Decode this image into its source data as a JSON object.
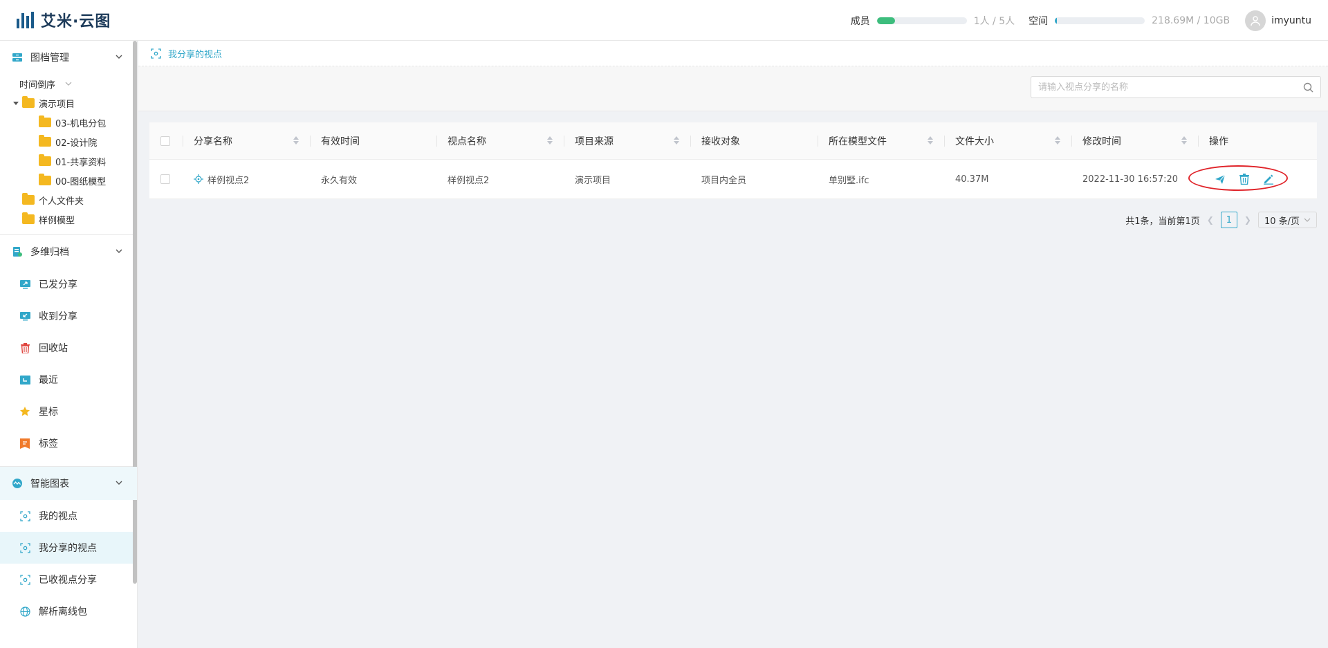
{
  "header": {
    "brand": "艾米·云图",
    "members_label": "成员",
    "members_value": "1人 / 5人",
    "members_progress": 0.2,
    "space_label": "空间",
    "space_value": "218.69M / 10GB",
    "space_progress": 0.02,
    "username": "imyuntu",
    "colors": {
      "members_fill": "#3dbd7d",
      "space_fill": "#31a7c9"
    }
  },
  "sidebar": {
    "archive_group": "图档管理",
    "sort_label": "时间倒序",
    "tree": {
      "root": "演示项目",
      "children": [
        "03-机电分包",
        "02-设计院",
        "01-共享资料",
        "00-图纸模型"
      ],
      "siblings": [
        "个人文件夹",
        "样例模型"
      ]
    },
    "multi_group": "多维归档",
    "multi_items": [
      "已发分享",
      "收到分享",
      "回收站",
      "最近",
      "星标",
      "标签"
    ],
    "smart_group": "智能图表",
    "smart_items": [
      "我的视点",
      "我分享的视点",
      "已收视点分享",
      "解析离线包"
    ]
  },
  "breadcrumb": {
    "current": "我分享的视点"
  },
  "search": {
    "placeholder": "请输入视点分享的名称",
    "value": ""
  },
  "table": {
    "columns": [
      "分享名称",
      "有效时间",
      "视点名称",
      "项目来源",
      "接收对象",
      "所在模型文件",
      "文件大小",
      "修改时间",
      "操作"
    ],
    "rows": [
      {
        "share_name": "样例视点2",
        "valid_time": "永久有效",
        "viewpoint_name": "样例视点2",
        "project_source": "演示项目",
        "receiver": "项目内全员",
        "model_file": "单别墅.ifc",
        "file_size": "40.37M",
        "modified": "2022-11-30 16:57:20"
      }
    ]
  },
  "pagination": {
    "summary": "共1条，当前第1页",
    "current_page": "1",
    "page_size": "10 条/页"
  }
}
